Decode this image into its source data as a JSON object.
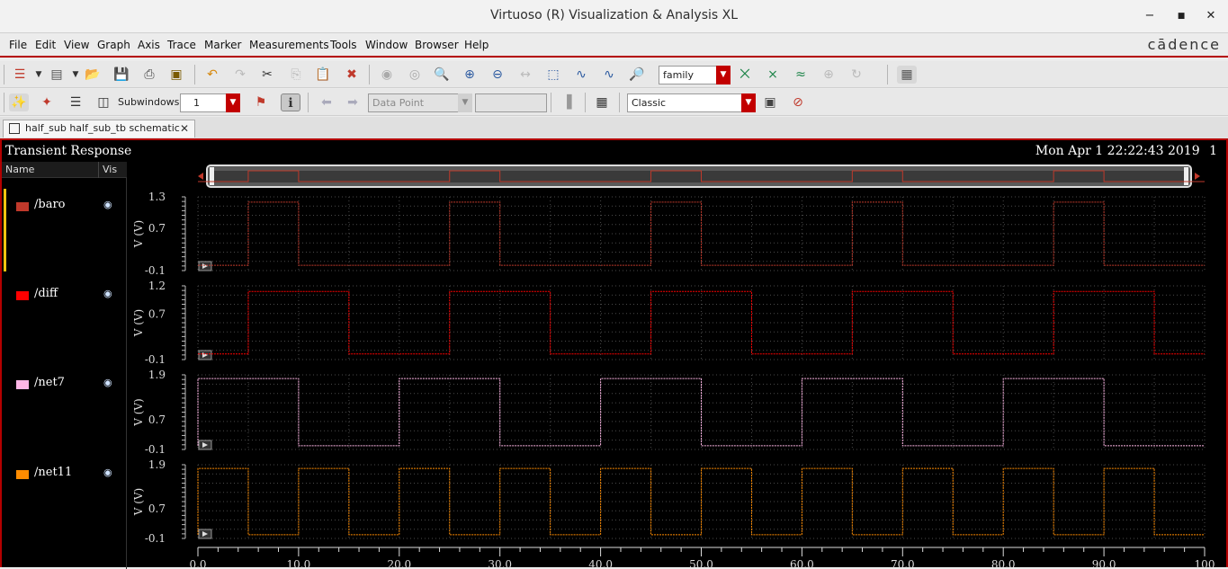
{
  "window": {
    "title": "Virtuoso (R) Visualization & Analysis XL",
    "minimize": "−",
    "maximize": "■",
    "close": "✕"
  },
  "menu": {
    "items": [
      "File",
      "Edit",
      "View",
      "Graph",
      "Axis",
      "Trace",
      "Marker",
      "Measurements",
      "Tools",
      "Window",
      "Browser",
      "Help"
    ],
    "brand": "cādence"
  },
  "toolbar1": {
    "family_combo": "family"
  },
  "toolbar2": {
    "subwindows_label": "Subwindows:",
    "subwindows_value": "1",
    "data_point_combo": "Data Point",
    "data_point_value": "",
    "style_combo": "Classic"
  },
  "tab": {
    "label": "half_sub half_sub_tb schematic"
  },
  "plot": {
    "title": "Transient Response",
    "timestamp": "Mon Apr 1 22:22:43 2019",
    "subwindow_index": "1",
    "legend_headers": [
      "Name",
      "Vis"
    ],
    "xaxis_ticks": [
      "0.0",
      "10.0",
      "20.0",
      "30.0",
      "40.0",
      "50.0",
      "60.0",
      "70.0",
      "80.0",
      "90.0",
      "100"
    ],
    "traces": [
      {
        "name": "/baro",
        "color": "#c0392b",
        "ylabel": "V (V)",
        "yticks": [
          "1.3",
          "0.7",
          "-0.1"
        ]
      },
      {
        "name": "/diff",
        "color": "#ff0000",
        "ylabel": "V (V)",
        "yticks": [
          "1.2",
          "0.7",
          "-0.1"
        ]
      },
      {
        "name": "/net7",
        "color": "#ffb6e6",
        "ylabel": "V (V)",
        "yticks": [
          "1.9",
          "0.7",
          "-0.1"
        ]
      },
      {
        "name": "/net11",
        "color": "#ff8c00",
        "ylabel": "V (V)",
        "yticks": [
          "1.9",
          "0.7",
          "-0.1"
        ]
      }
    ]
  },
  "chart_data": {
    "type": "line",
    "xlim": [
      0,
      100
    ],
    "x_ticks": [
      0,
      10,
      20,
      30,
      40,
      50,
      60,
      70,
      80,
      90,
      100
    ],
    "series": [
      {
        "name": "/baro",
        "ylim": [
          -0.1,
          1.3
        ],
        "low": 0.0,
        "high": 1.2,
        "high_intervals": [
          [
            5,
            10
          ],
          [
            25,
            30
          ],
          [
            45,
            50
          ],
          [
            65,
            70
          ],
          [
            85,
            90
          ]
        ]
      },
      {
        "name": "/diff",
        "ylim": [
          -0.1,
          1.2
        ],
        "low": 0.0,
        "high": 1.1,
        "high_intervals": [
          [
            5,
            15
          ],
          [
            25,
            35
          ],
          [
            45,
            55
          ],
          [
            65,
            75
          ],
          [
            85,
            95
          ]
        ]
      },
      {
        "name": "/net7",
        "ylim": [
          -0.1,
          1.9
        ],
        "low": 0.0,
        "high": 1.8,
        "high_intervals": [
          [
            0,
            10
          ],
          [
            20,
            30
          ],
          [
            40,
            50
          ],
          [
            60,
            70
          ],
          [
            80,
            90
          ]
        ]
      },
      {
        "name": "/net11",
        "ylim": [
          -0.1,
          1.9
        ],
        "low": 0.0,
        "high": 1.8,
        "high_intervals": [
          [
            0,
            5
          ],
          [
            10,
            15
          ],
          [
            20,
            25
          ],
          [
            30,
            35
          ],
          [
            40,
            45
          ],
          [
            50,
            55
          ],
          [
            60,
            65
          ],
          [
            70,
            75
          ],
          [
            80,
            85
          ],
          [
            90,
            95
          ]
        ]
      }
    ]
  }
}
